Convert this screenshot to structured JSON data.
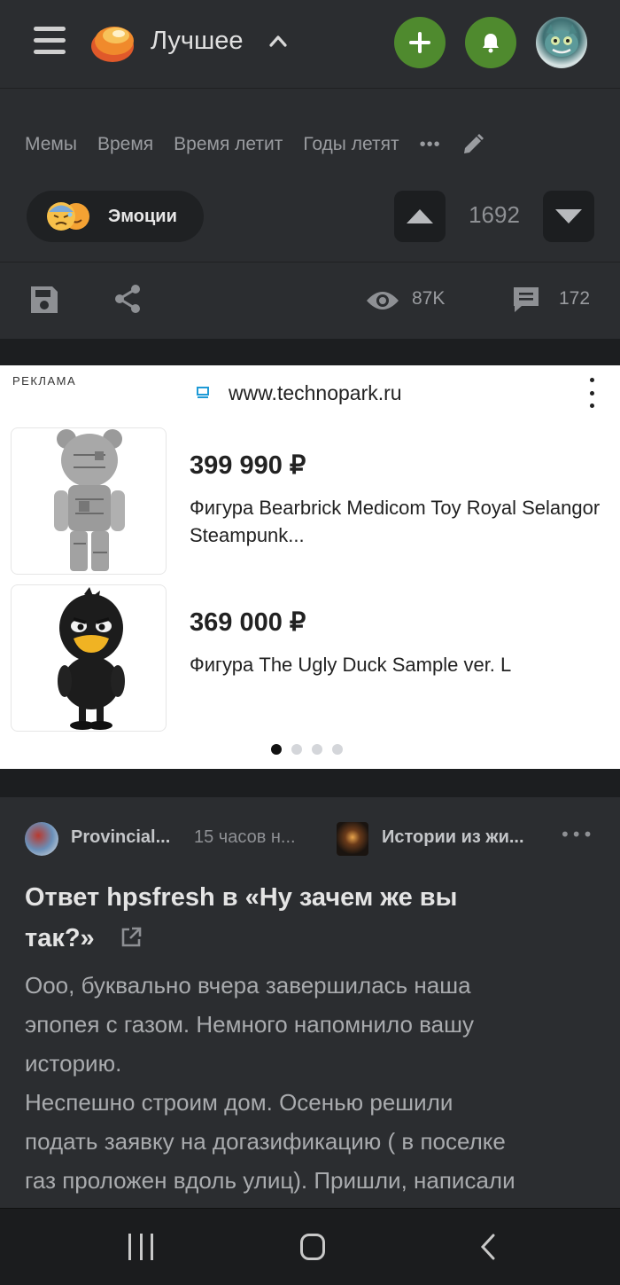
{
  "header": {
    "title": "Лучшее",
    "icons": [
      "hamburger-menu-icon",
      "app-logo",
      "chevron-up-icon",
      "plus-icon",
      "bell-icon",
      "avatar"
    ],
    "accent_color": "#4f8a2e"
  },
  "tags": [
    "Мемы",
    "Время",
    "Время летит",
    "Годы летят"
  ],
  "tags_more": "•••",
  "community_chip": {
    "label": "Эмоции"
  },
  "rating": {
    "value": "1692"
  },
  "stats": {
    "views": "87K",
    "comments": "172"
  },
  "ad": {
    "label": "РЕКЛАМА",
    "domain": "www.technopark.ru",
    "products": [
      {
        "price": "399 990 ₽",
        "name": "Фигура Bearbrick Medicom Toy Royal Selangor Steampunk..."
      },
      {
        "price": "369 000 ₽",
        "name": "Фигура The Ugly Duck Sample ver. L"
      }
    ],
    "pager": {
      "total": 4,
      "active": 0
    }
  },
  "post": {
    "author": "Provincial...",
    "time": "15 часов н...",
    "community": "Истории из жи...",
    "more": "•••",
    "title": "Ответ hpsfresh в «Ну зачем же вы так?»",
    "body_lines": [
      "Ооо, буквально вчера завершилась наша",
      "эпопея с газом. Немного напомнило вашу",
      "историю.",
      "Неспешно строим дом. Осенью решили",
      "подать заявку на догазификацию ( в поселке",
      "газ проложен вдоль улиц). Пришли, написали"
    ]
  }
}
